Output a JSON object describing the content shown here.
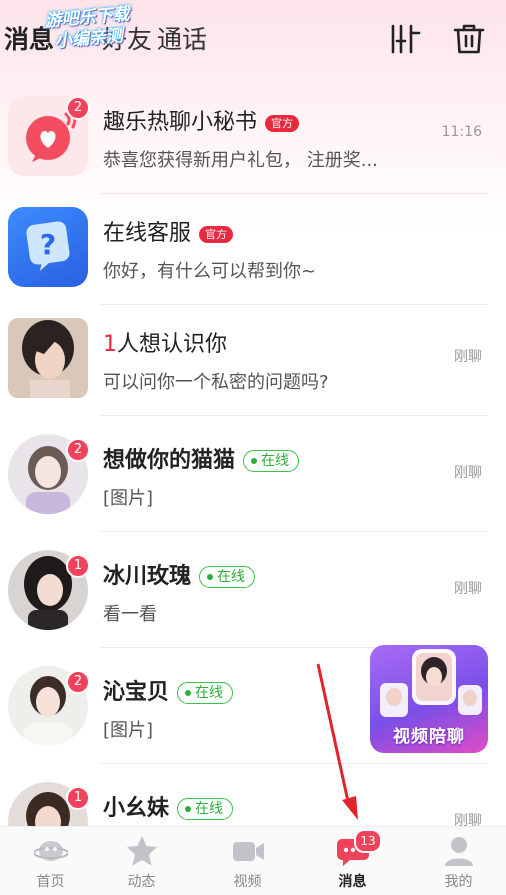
{
  "header": {
    "tabs": [
      {
        "label": "消息"
      },
      {
        "label": "好友"
      },
      {
        "label": "通话"
      }
    ],
    "watermark": [
      "游吧乐下载",
      "小编亲测"
    ]
  },
  "conversations": [
    {
      "name": "趣乐热聊小秘书",
      "tag": "官方",
      "preview": "恭喜您获得新用户礼包， 注册奖...",
      "time": "11:16",
      "badge": "2"
    },
    {
      "name": "在线客服",
      "tag": "官方",
      "preview": "你好，有什么可以帮到你~",
      "time": "",
      "badge": ""
    },
    {
      "name_num": "1",
      "name": "人想认识你",
      "preview": "可以问你一个私密的问题吗?",
      "time": "刚聊",
      "badge": ""
    },
    {
      "name": "想做你的猫猫",
      "tag": "在线",
      "preview": "[图片]",
      "time": "刚聊",
      "badge": "2"
    },
    {
      "name": "冰川玫瑰",
      "tag": "在线",
      "preview": "看一看",
      "time": "刚聊",
      "badge": "1"
    },
    {
      "name": "沁宝贝",
      "tag": "在线",
      "preview": "[图片]",
      "time": "",
      "badge": "2"
    },
    {
      "name": "小幺妹",
      "tag": "在线",
      "preview": "",
      "time": "刚聊",
      "badge": "1"
    }
  ],
  "promo": {
    "label": "视频陪聊"
  },
  "bottom_nav": {
    "items": [
      {
        "label": "首页",
        "icon": "planet-icon"
      },
      {
        "label": "动态",
        "icon": "star-icon"
      },
      {
        "label": "视频",
        "icon": "video-camera-icon"
      },
      {
        "label": "消息",
        "icon": "chat-bubble-icon",
        "badge": "13"
      },
      {
        "label": "我的",
        "icon": "person-icon"
      }
    ]
  }
}
